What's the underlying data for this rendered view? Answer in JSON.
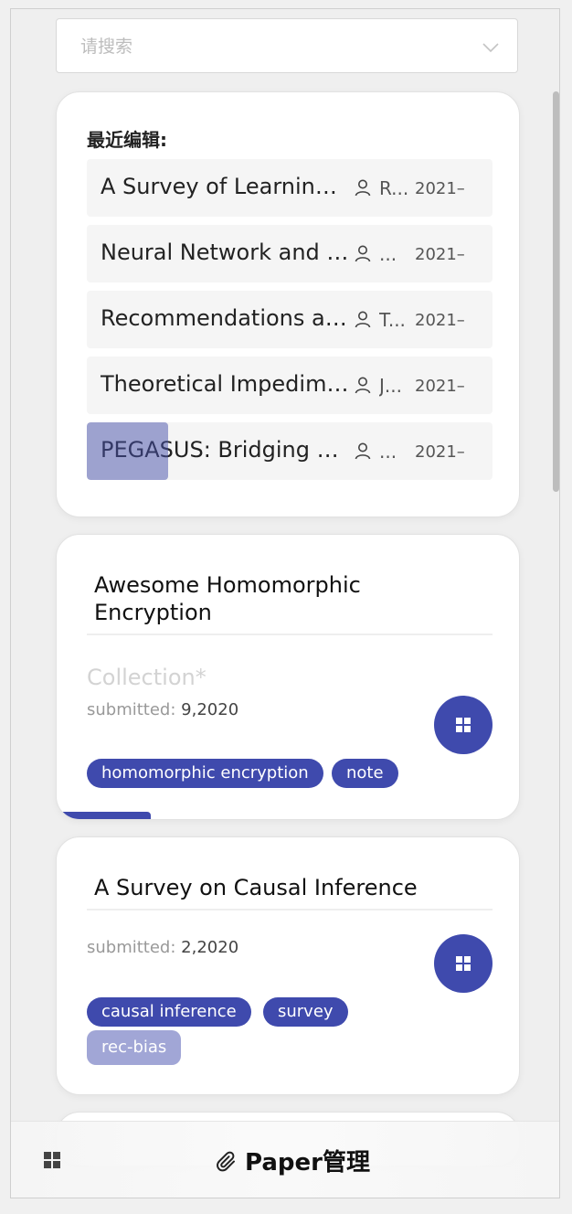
{
  "search": {
    "placeholder": "请搜索"
  },
  "recent": {
    "title": "最近编辑:",
    "items": [
      {
        "title": "A Survey of Learning Causality",
        "author": "R...",
        "date": "2021–"
      },
      {
        "title": "Neural Network and Deep Learning",
        "author": "...",
        "date": "2021–"
      },
      {
        "title": "Recommendations as Treatments",
        "author": "T...",
        "date": "2021–"
      },
      {
        "title": "Theoretical Impediments to ML",
        "author": "J...",
        "date": "2021–"
      },
      {
        "title": "PEGASUS: Bridging Polynomial",
        "author": "...",
        "date": "2021–"
      }
    ]
  },
  "papers": [
    {
      "title": "Awesome Homomorphic Encryption",
      "collection": "Collection*",
      "submitted_label": "submitted:",
      "submitted_value": "9,2020",
      "tags": [
        "homomorphic encryption",
        "note"
      ]
    },
    {
      "title": "A Survey on Causal Inference",
      "submitted_label": "submitted:",
      "submitted_value": "2,2020",
      "tags": [
        "causal inference",
        "survey",
        "rec-bias"
      ]
    }
  ],
  "bottom_bar": {
    "title": "Paper管理"
  },
  "colors": {
    "accent": "#3f4aad",
    "accent_light": "#a1a6d6"
  }
}
